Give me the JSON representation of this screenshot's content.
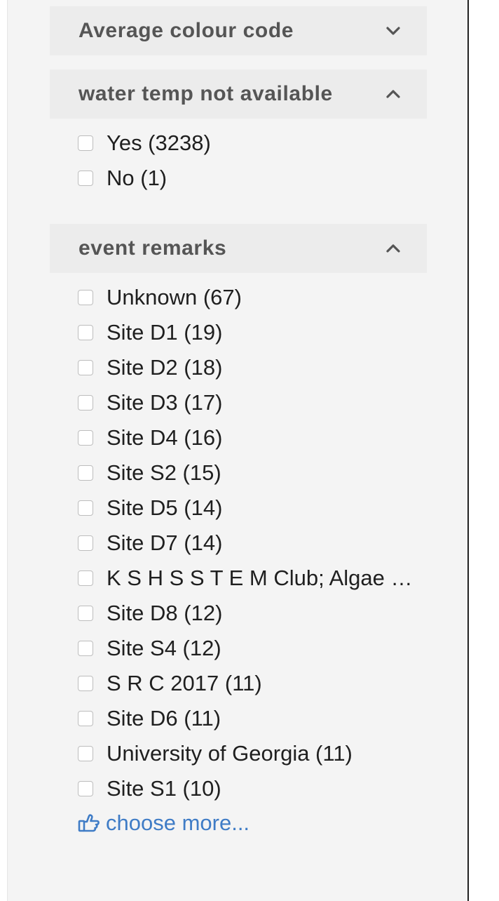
{
  "facets": [
    {
      "title": "Average colour code",
      "expanded": false,
      "chevron_icon": "chevron-down-icon",
      "items": []
    },
    {
      "title": "water temp not available",
      "expanded": true,
      "chevron_icon": "chevron-up-icon",
      "items": [
        {
          "label": "Yes (3238)",
          "checked": false
        },
        {
          "label": "No (1)",
          "checked": false
        }
      ]
    },
    {
      "title": "event remarks",
      "expanded": true,
      "chevron_icon": "chevron-up-icon",
      "items": [
        {
          "label": "Unknown (67)",
          "checked": false
        },
        {
          "label": "Site D1 (19)",
          "checked": false
        },
        {
          "label": "Site D2 (18)",
          "checked": false
        },
        {
          "label": "Site D3 (17)",
          "checked": false
        },
        {
          "label": "Site D4 (16)",
          "checked": false
        },
        {
          "label": "Site S2 (15)",
          "checked": false
        },
        {
          "label": "Site D5 (14)",
          "checked": false
        },
        {
          "label": "Site D7 (14)",
          "checked": false
        },
        {
          "label": "K S H S S T E M Club; Algae …",
          "checked": false
        },
        {
          "label": "Site D8 (12)",
          "checked": false
        },
        {
          "label": "Site S4 (12)",
          "checked": false
        },
        {
          "label": "S R C 2017 (11)",
          "checked": false
        },
        {
          "label": "Site D6 (11)",
          "checked": false
        },
        {
          "label": "University of Georgia (11)",
          "checked": false
        },
        {
          "label": "Site S1 (10)",
          "checked": false
        }
      ],
      "more_link": {
        "label": "choose more...",
        "icon": "thumbs-up-hand-icon"
      }
    }
  ],
  "colors": {
    "panel_bg": "#f4f4f4",
    "header_bg": "#ececec",
    "header_text": "#555555",
    "item_text": "#1f1f1f",
    "link": "#3f7cc6"
  }
}
